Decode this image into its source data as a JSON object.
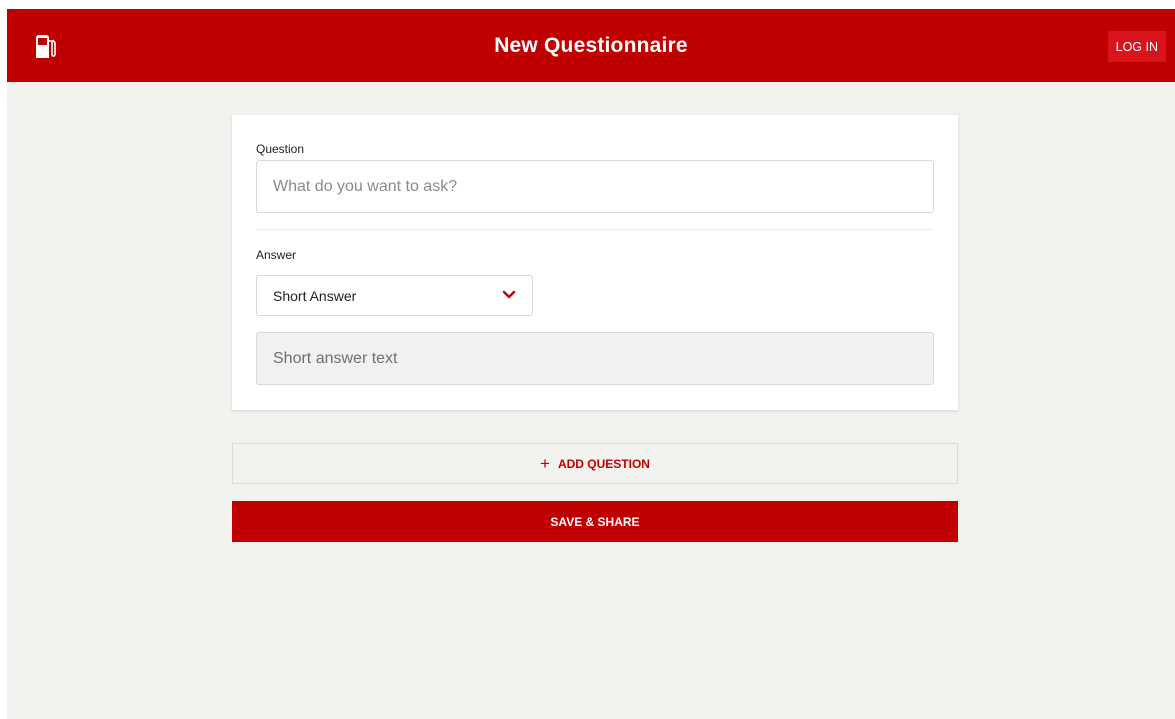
{
  "header": {
    "title": "New Questionnaire",
    "login_label": "LOG IN",
    "logo_icon": "fuel-pump-icon",
    "background_color": "#c00000"
  },
  "question_card": {
    "question_label": "Question",
    "question_placeholder": "What do you want to ask?",
    "question_value": "",
    "answer_label": "Answer",
    "answer_type_selected": "Short Answer",
    "answer_preview_text": "Short answer text"
  },
  "actions": {
    "add_question_label": "ADD QUESTION",
    "add_question_icon": "plus-icon",
    "save_share_label": "SAVE & SHARE"
  },
  "colors": {
    "accent": "#c00000",
    "page_background": "#f2f2ef"
  }
}
